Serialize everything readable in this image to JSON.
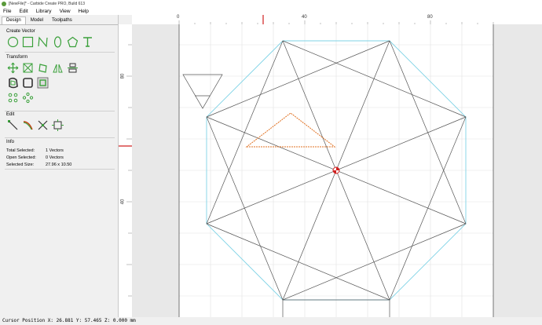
{
  "window": {
    "title": "[NewFile]* - Carbide Create PRO, Build 613"
  },
  "menu": [
    "File",
    "Edit",
    "Library",
    "View",
    "Help"
  ],
  "tabs": [
    "Design",
    "Model",
    "Toolpaths"
  ],
  "sections": {
    "create_vector": "Create Vector",
    "transform": "Transform",
    "edit": "Edit",
    "info": "Info"
  },
  "info": {
    "total_selected_label": "Total Selected:",
    "total_selected_value": "1 Vectors",
    "open_selected_label": "Open Selected:",
    "open_selected_value": "0 Vectors",
    "selected_size_label": "Selected Size:",
    "selected_size_value": "27.96 x 10.50"
  },
  "rulers": {
    "top": [
      "0",
      "40",
      "80"
    ],
    "left": [
      "80",
      "40"
    ]
  },
  "status": {
    "cursor": "Cursor Position X: 26.881 Y: 57.465 Z: 0.000 mm"
  },
  "colors": {
    "accent": "#3aa03a",
    "selection": "#e07020",
    "stock_outline": "#7fd3e6",
    "marker": "#d02020"
  }
}
